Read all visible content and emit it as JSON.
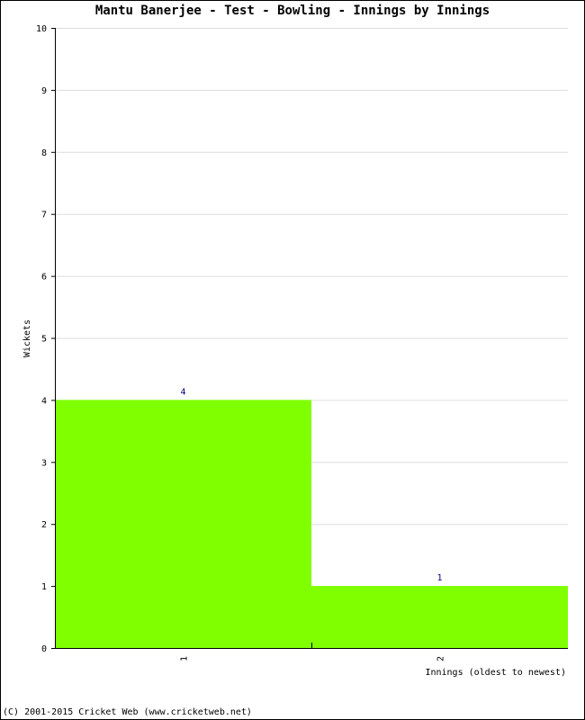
{
  "chart_data": {
    "type": "bar",
    "title": "Mantu Banerjee - Test - Bowling - Innings by Innings",
    "xlabel": "Innings (oldest to newest)",
    "ylabel": "Wickets",
    "categories": [
      "1",
      "2"
    ],
    "values": [
      4,
      1
    ],
    "data_labels": [
      "4",
      "1"
    ],
    "ylim": [
      0,
      10
    ],
    "yticks": [
      0,
      1,
      2,
      3,
      4,
      5,
      6,
      7,
      8,
      9,
      10
    ],
    "grid": true,
    "bar_color": "#80ff00",
    "label_color": "#000080"
  },
  "footer": "(C) 2001-2015 Cricket Web (www.cricketweb.net)"
}
